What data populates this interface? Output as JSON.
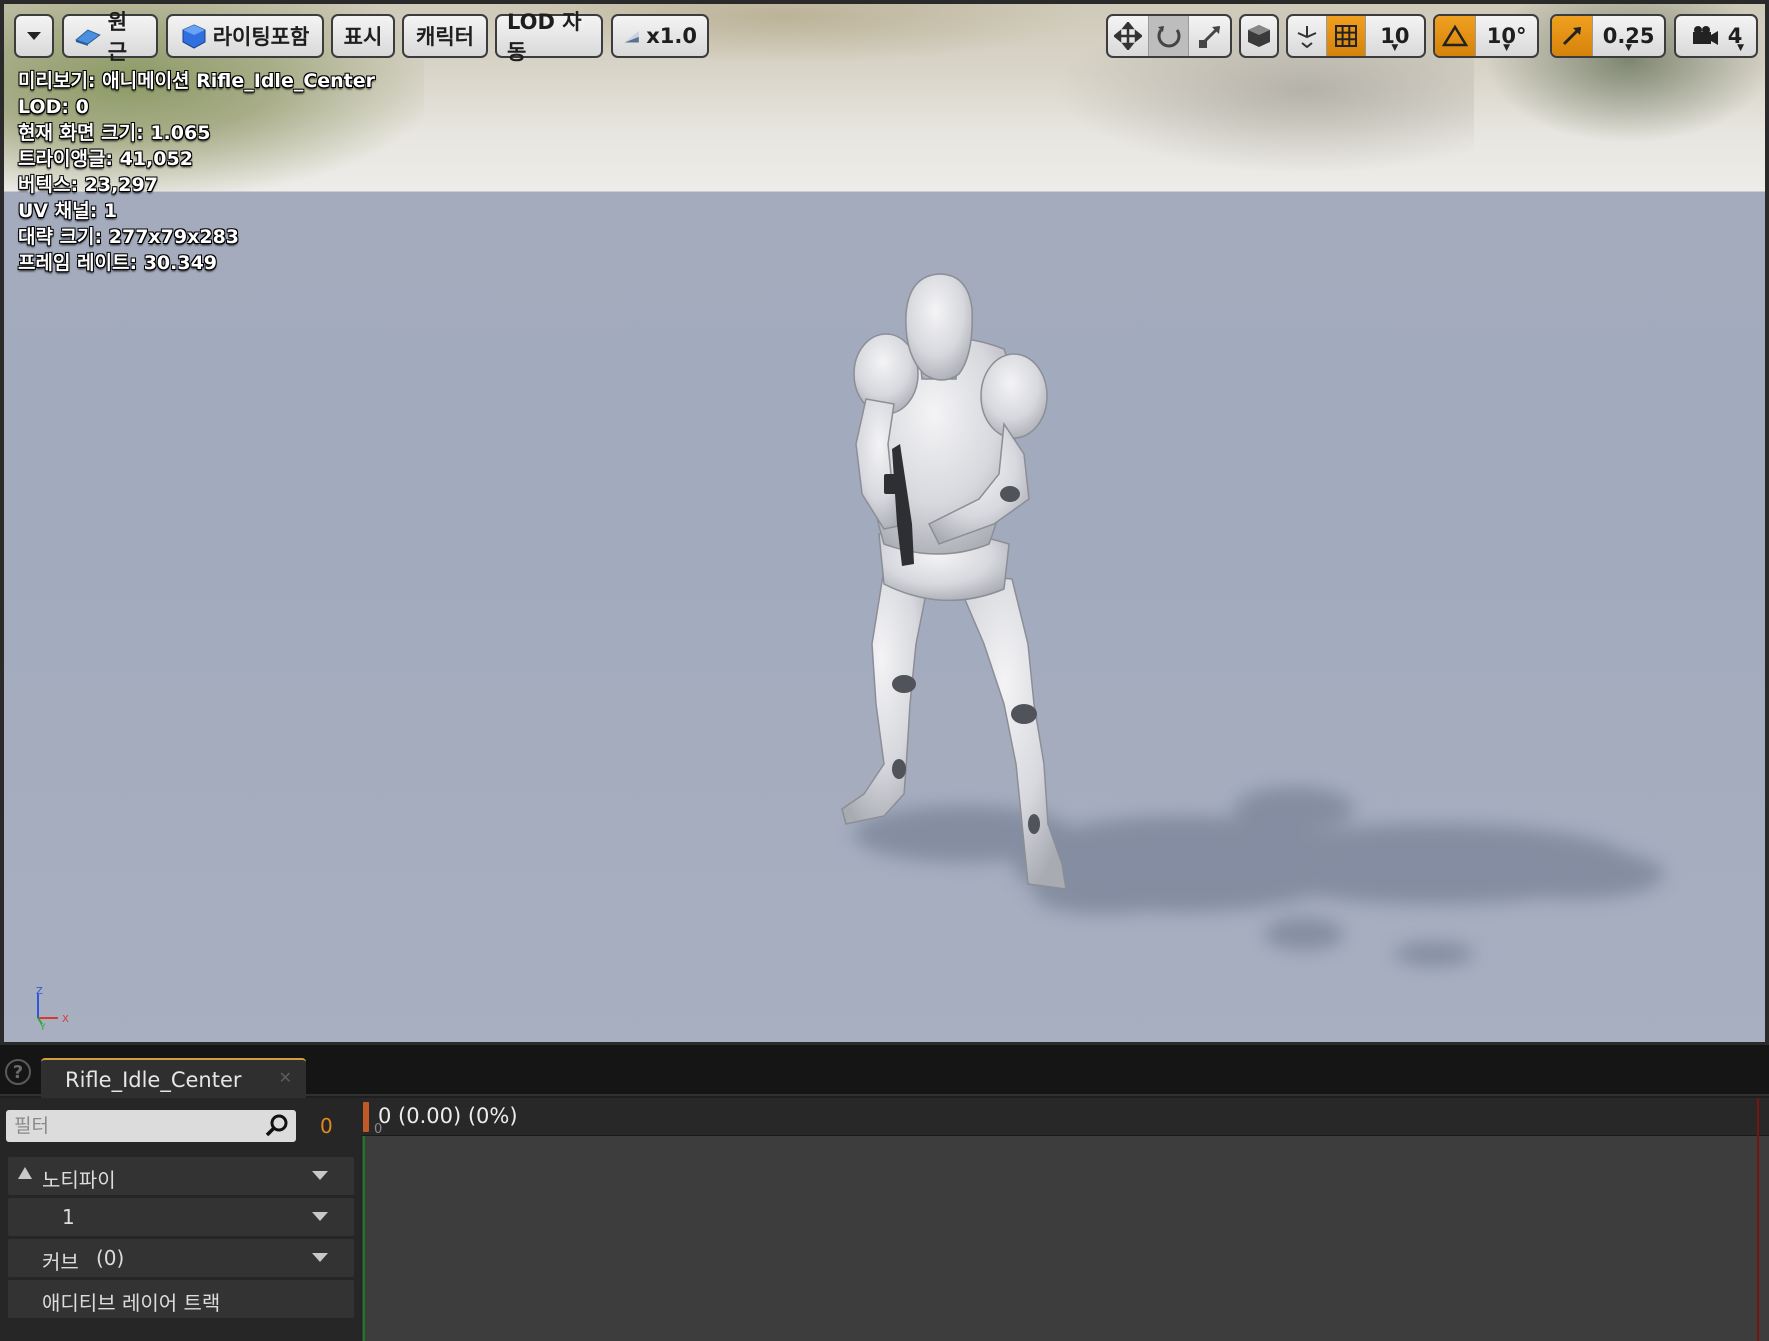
{
  "toolbar": {
    "perspective_label": "원근",
    "lighting_label": "라이팅포함",
    "show_label": "표시",
    "character_label": "캐릭터",
    "lod_label": "LOD 자동",
    "speed_label": "x1.0",
    "grid_snap_value": "10",
    "rotation_snap_value": "10°",
    "scale_snap_value": "0.25",
    "camera_speed_value": "4",
    "accent_color": "#e0901a"
  },
  "stats": {
    "preview": "미리보기: 애니메이션 Rifle_Idle_Center",
    "lod": "LOD: 0",
    "screen_size": "현재 화면 크기: 1.065",
    "triangles": "트라이앵글: 41,052",
    "vertices": "버텍스: 23,297",
    "uv_channels": "UV 채널: 1",
    "approx_size": "대략 크기: 277x79x283",
    "frame_rate": "프레임 레이트: 30.349"
  },
  "axis": {
    "z": "Z",
    "x": "X",
    "y": "Y"
  },
  "bottom": {
    "tab_label": "Rifle_Idle_Center",
    "filter_placeholder": "필터",
    "current_frame": "0",
    "tracks": {
      "notifies_label": "노티파이",
      "notify_track_1": "1",
      "curves_label": "커브",
      "curves_count": "(0)",
      "additive_label": "애디티브 레이어 트랙"
    },
    "timeline": {
      "position_label": "0 (0.00) (0%)",
      "ruler_start": "0"
    }
  }
}
